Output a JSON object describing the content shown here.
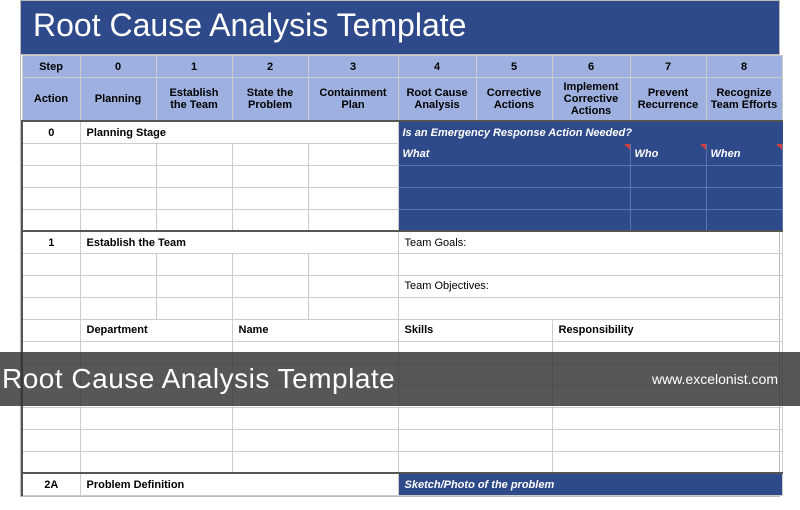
{
  "title": "Root Cause Analysis Template",
  "header_row1": {
    "step": "Step",
    "cols": [
      "0",
      "1",
      "2",
      "3",
      "4",
      "5",
      "6",
      "7",
      "8"
    ]
  },
  "header_row2": {
    "action": "Action",
    "cols": [
      "Planning",
      "Establish the Team",
      "State the Problem",
      "Containment Plan",
      "Root Cause Analysis",
      "Corrective Actions",
      "Implement Corrective Actions",
      "Prevent Recurrence",
      "Recognize Team Efforts"
    ]
  },
  "rows": {
    "r0": {
      "step": "0",
      "label": "Planning Stage",
      "emergency_q": "Is an Emergency Response Action Needed?",
      "what": "What",
      "who": "Who",
      "when": "When"
    },
    "r1": {
      "step": "1",
      "label": "Establish the Team",
      "team_goals": "Team Goals:",
      "team_objectives": "Team Objectives:"
    },
    "sub1": {
      "department": "Department",
      "name": "Name",
      "skills": "Skills",
      "responsibility": "Responsibility"
    },
    "r2a": {
      "step": "2A",
      "label": "Problem Definition",
      "sketch": "Sketch/Photo of the problem"
    }
  },
  "overlay": {
    "title": "Root Cause Analysis Template",
    "url": "www.excelonist.com"
  }
}
